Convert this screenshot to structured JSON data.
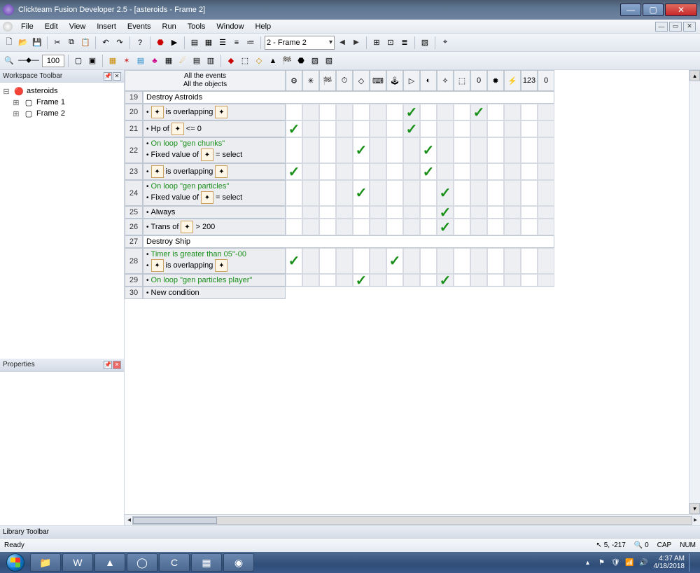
{
  "window": {
    "title": "Clickteam Fusion Developer 2.5 - [asteroids - Frame 2]"
  },
  "menu": {
    "items": [
      "File",
      "Edit",
      "View",
      "Insert",
      "Events",
      "Run",
      "Tools",
      "Window",
      "Help"
    ]
  },
  "toolbar1": {
    "frame_selector": "2 - Frame 2",
    "zoom": "100"
  },
  "workspace": {
    "title": "Workspace Toolbar",
    "tree": {
      "root": "asteroids",
      "frames": [
        "Frame 1",
        "Frame 2"
      ]
    }
  },
  "properties": {
    "title": "Properties"
  },
  "library": {
    "title": "Library Toolbar"
  },
  "eventeditor": {
    "header": {
      "line1": "All the events",
      "line2": "All the objects"
    },
    "columns_count": 16,
    "rows": [
      {
        "num": 19,
        "type": "group",
        "label": "Destroy Astroids"
      },
      {
        "num": 20,
        "type": "cond",
        "lines": [
          {
            "parts": [
              {
                "t": "icon",
                "v": "star"
              },
              {
                "t": "text",
                "v": "is overlapping"
              },
              {
                "t": "icon",
                "v": "asteroid"
              }
            ]
          }
        ],
        "checks": [
          8,
          12
        ]
      },
      {
        "num": 21,
        "type": "cond",
        "lines": [
          {
            "parts": [
              {
                "t": "text",
                "v": "Hp of"
              },
              {
                "t": "icon",
                "v": "asteroid"
              },
              {
                "t": "text",
                "v": "<= 0"
              }
            ]
          }
        ],
        "checks": [
          1,
          8
        ]
      },
      {
        "num": 22,
        "type": "cond",
        "lines": [
          {
            "green": true,
            "parts": [
              {
                "t": "text",
                "v": "On loop \"gen chunks\""
              }
            ]
          },
          {
            "parts": [
              {
                "t": "text",
                "v": "Fixed value of"
              },
              {
                "t": "icon",
                "v": "asteroid"
              },
              {
                "t": "text",
                "v": "= select"
              }
            ]
          }
        ],
        "checks": [
          5,
          9
        ]
      },
      {
        "num": 23,
        "type": "cond",
        "lines": [
          {
            "parts": [
              {
                "t": "icon",
                "v": "star"
              },
              {
                "t": "text",
                "v": "is overlapping"
              },
              {
                "t": "icon",
                "v": "chunk"
              }
            ]
          }
        ],
        "checks": [
          1,
          9
        ]
      },
      {
        "num": 24,
        "type": "cond",
        "lines": [
          {
            "green": true,
            "parts": [
              {
                "t": "text",
                "v": "On loop \"gen particles\""
              }
            ]
          },
          {
            "parts": [
              {
                "t": "text",
                "v": "Fixed value of"
              },
              {
                "t": "icon",
                "v": "chunk"
              },
              {
                "t": "text",
                "v": "= select"
              }
            ]
          }
        ],
        "checks": [
          5,
          10
        ]
      },
      {
        "num": 25,
        "type": "cond",
        "lines": [
          {
            "parts": [
              {
                "t": "text",
                "v": "Always"
              }
            ]
          }
        ],
        "checks": [
          10
        ]
      },
      {
        "num": 26,
        "type": "cond",
        "lines": [
          {
            "parts": [
              {
                "t": "text",
                "v": "Trans of"
              },
              {
                "t": "icon",
                "v": "particle"
              },
              {
                "t": "text",
                "v": "> 200"
              }
            ]
          }
        ],
        "checks": [
          10
        ]
      },
      {
        "num": 27,
        "type": "group",
        "label": "Destroy Ship"
      },
      {
        "num": 28,
        "type": "cond",
        "lines": [
          {
            "green": true,
            "parts": [
              {
                "t": "text",
                "v": "Timer is greater than 05''-00"
              }
            ]
          },
          {
            "parts": [
              {
                "t": "icon",
                "v": "ship"
              },
              {
                "t": "text",
                "v": "is overlapping"
              },
              {
                "t": "icon",
                "v": "explosion"
              }
            ]
          }
        ],
        "checks": [
          1,
          7
        ]
      },
      {
        "num": 29,
        "type": "cond",
        "lines": [
          {
            "green": true,
            "parts": [
              {
                "t": "text",
                "v": "On loop \"gen particles player\""
              }
            ]
          }
        ],
        "checks": [
          5,
          10
        ]
      },
      {
        "num": 30,
        "type": "cond",
        "lines": [
          {
            "parts": [
              {
                "t": "text",
                "v": "New condition"
              }
            ]
          }
        ],
        "checks": [],
        "no_cells": true
      }
    ],
    "header_icons": [
      "⚙",
      "✳",
      "🏁",
      "⏱",
      "◇",
      "⌨",
      "🕹",
      "▷",
      "◐",
      "⟡",
      "⬚",
      "0",
      "✹",
      "⚡",
      "123",
      "0"
    ]
  },
  "statusbar": {
    "ready": "Ready",
    "coords_icon": "↖",
    "coords": "5, -217",
    "zoom_icon": "🔍",
    "zoom": "0",
    "cap": "CAP",
    "num": "NUM"
  },
  "taskbar": {
    "items": [
      "📁",
      "W",
      "▲",
      "◯",
      "C",
      "▦",
      "◉"
    ],
    "tray_icons": [
      "▴",
      "⚑",
      "🛡",
      "📶",
      "🔊"
    ],
    "time": "4:37 AM",
    "date": "4/18/2018"
  }
}
